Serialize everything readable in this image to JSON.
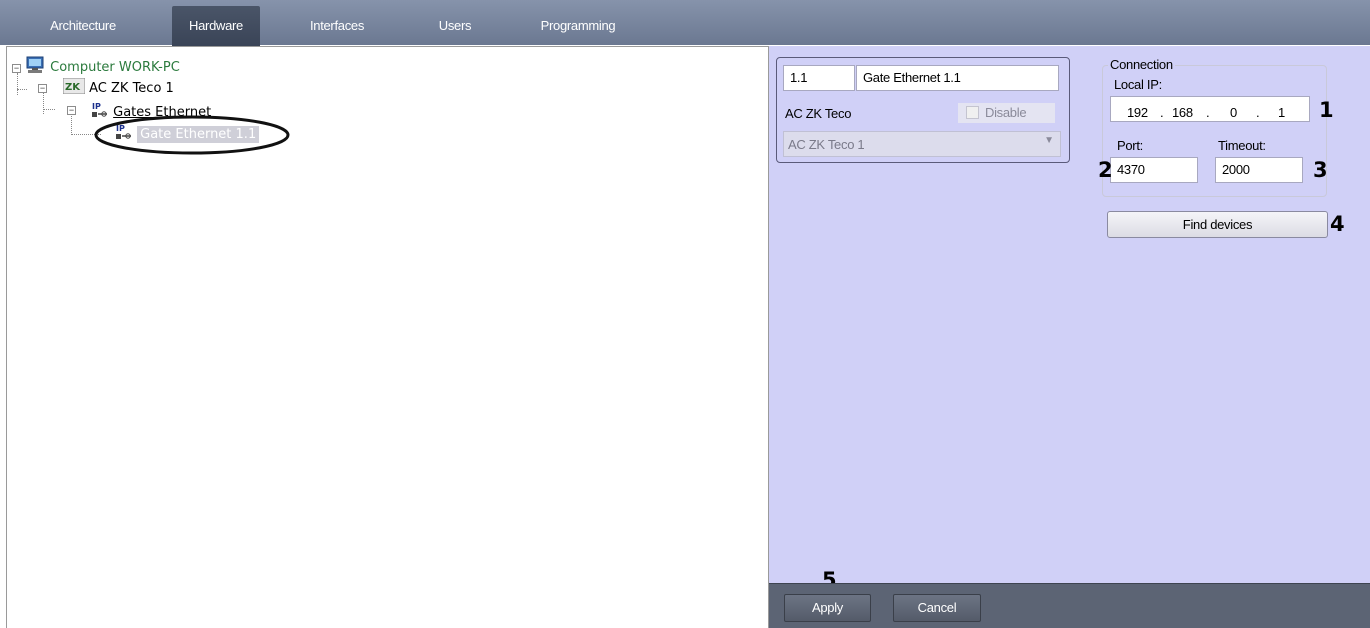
{
  "tabs": [
    {
      "label": "Architecture",
      "active": false
    },
    {
      "label": "Hardware",
      "active": true
    },
    {
      "label": "Interfaces",
      "active": false
    },
    {
      "label": "Users",
      "active": false
    },
    {
      "label": "Programming",
      "active": false
    }
  ],
  "tree": {
    "computer": {
      "label": "Computer WORK-PC",
      "icon": "computer-icon",
      "color": "#2b7a3d"
    },
    "controller": {
      "label": "AC ZK Teco 1",
      "icon": "zk-teco-icon"
    },
    "gates": {
      "label": "Gates Ethernet",
      "icon": "ip-network-icon"
    },
    "gate": {
      "label": "Gate Ethernet 1.1",
      "icon": "ip-network-icon",
      "selected": true
    }
  },
  "object": {
    "id": "1.1",
    "name": "Gate Ethernet 1.1",
    "type_label": "AC ZK Teco",
    "disable_label": "Disable",
    "parent_value": "AC ZK Teco 1"
  },
  "connection": {
    "group_label": "Connection",
    "local_ip_label": "Local IP:",
    "ip": [
      "192",
      "168",
      "0",
      "1"
    ],
    "port_label": "Port:",
    "port_value": "4370",
    "timeout_label": "Timeout:",
    "timeout_value": "2000",
    "find_button": "Find devices"
  },
  "footer": {
    "apply": "Apply",
    "cancel": "Cancel"
  },
  "callouts": [
    "1",
    "2",
    "3",
    "4",
    "5"
  ],
  "colors": {
    "panel_bg": "#d0d0f7",
    "tab_bar": "#7a869d",
    "tree_text_green": "#2b7a3d",
    "selection": "#cfcfd8"
  }
}
